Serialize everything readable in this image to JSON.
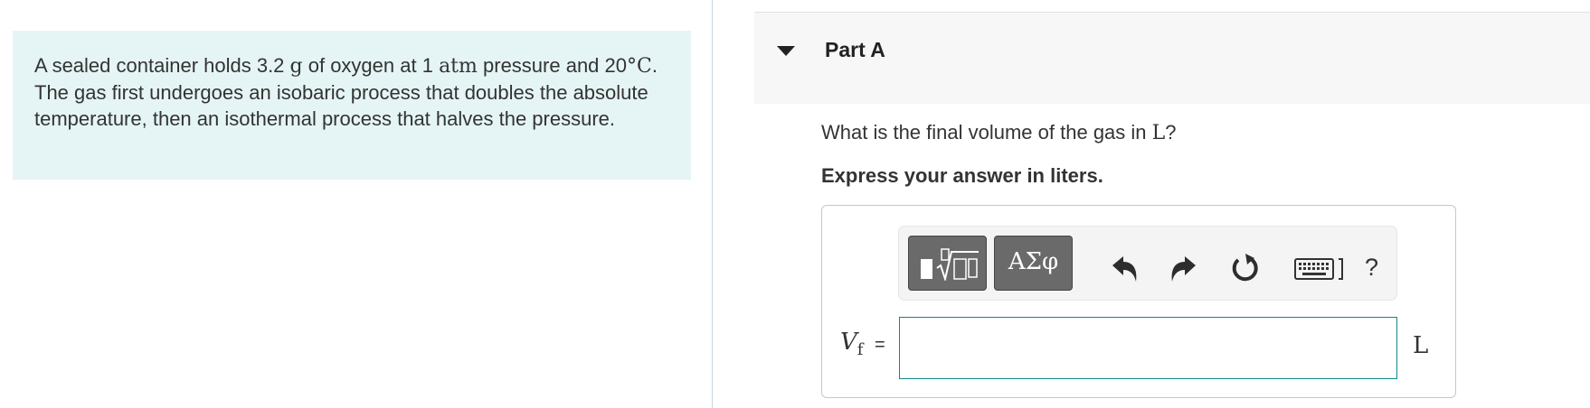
{
  "intro": {
    "p1": "A sealed container holds 3.2 ",
    "m1": "g",
    "p2": " of oxygen at 1 ",
    "m2": "atm",
    "p3": " pressure and 20",
    "m3": "°C",
    "p4": ". The gas first undergoes an isobaric process that doubles the absolute temperature, then an isothermal process that halves the pressure."
  },
  "part": {
    "title": "Part A"
  },
  "question": {
    "before": "What is the final volume of the gas in ",
    "unit": "L",
    "after": "?"
  },
  "instruction": "Express your answer in liters.",
  "toolbar": {
    "greek_label": "ΑΣφ",
    "help_label": "?"
  },
  "answer": {
    "variable": "V",
    "subscript": "f",
    "equals": "=",
    "value": "",
    "unit": "L"
  },
  "colors": {
    "intro_bg": "#e5f5f5",
    "header_bg": "#f7f7f7",
    "input_border": "#0f8a8a",
    "button_bg": "#6a6a6a"
  },
  "icons": [
    "caret-down-icon",
    "templates-icon",
    "undo-icon",
    "redo-icon",
    "reset-icon",
    "keyboard-icon",
    "help-icon"
  ]
}
